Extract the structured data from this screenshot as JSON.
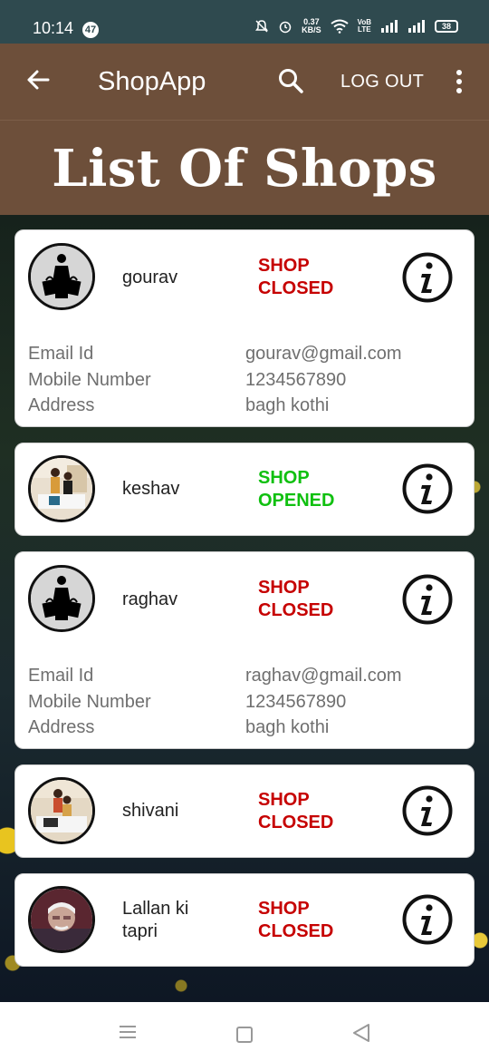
{
  "status_bar": {
    "time": "10:14",
    "notification_count": "47",
    "data_speed_value": "0.37",
    "data_speed_unit": "KB/S",
    "volte_top": "VoB",
    "volte_bottom": "LTE",
    "battery": "38"
  },
  "app_bar": {
    "title": "ShopApp",
    "logout_label": "LOG OUT"
  },
  "hero": {
    "title": "List Of Shops"
  },
  "shops": [
    {
      "name": "gourav",
      "status_line1": "SHOP",
      "status_line2": "CLOSED",
      "status": "closed",
      "avatar": "shopping-bags-icon",
      "details": [
        {
          "label": "Email Id",
          "value": "gourav@gmail.com"
        },
        {
          "label": "Mobile Number",
          "value": "1234567890"
        },
        {
          "label": "Address",
          "value": "bagh kothi"
        }
      ]
    },
    {
      "name": "keshav",
      "status_line1": "SHOP",
      "status_line2": "OPENED",
      "status": "opened",
      "avatar": "people-photo"
    },
    {
      "name": "raghav",
      "status_line1": "SHOP",
      "status_line2": "CLOSED",
      "status": "closed",
      "avatar": "shopping-bags-icon",
      "details": [
        {
          "label": "Email Id",
          "value": "raghav@gmail.com"
        },
        {
          "label": "Mobile Number",
          "value": "1234567890"
        },
        {
          "label": "Address",
          "value": "bagh kothi"
        }
      ]
    },
    {
      "name": "shivani",
      "status_line1": "SHOP",
      "status_line2": "CLOSED",
      "status": "closed",
      "avatar": "people-photo"
    },
    {
      "name_line1": "Lallan ki",
      "name_line2": "tapri",
      "status_line1": "SHOP",
      "status_line2": "CLOSED",
      "status": "closed",
      "avatar": "person-photo"
    }
  ],
  "colors": {
    "app_bar": "#6d4f3a",
    "status_bar": "#2f4a4f",
    "closed": "#c60000",
    "opened": "#10c010"
  },
  "icons": [
    "back-arrow-icon",
    "search-icon",
    "more-vert-icon",
    "info-icon",
    "nav-menu-icon",
    "nav-home-icon",
    "nav-back-icon"
  ]
}
